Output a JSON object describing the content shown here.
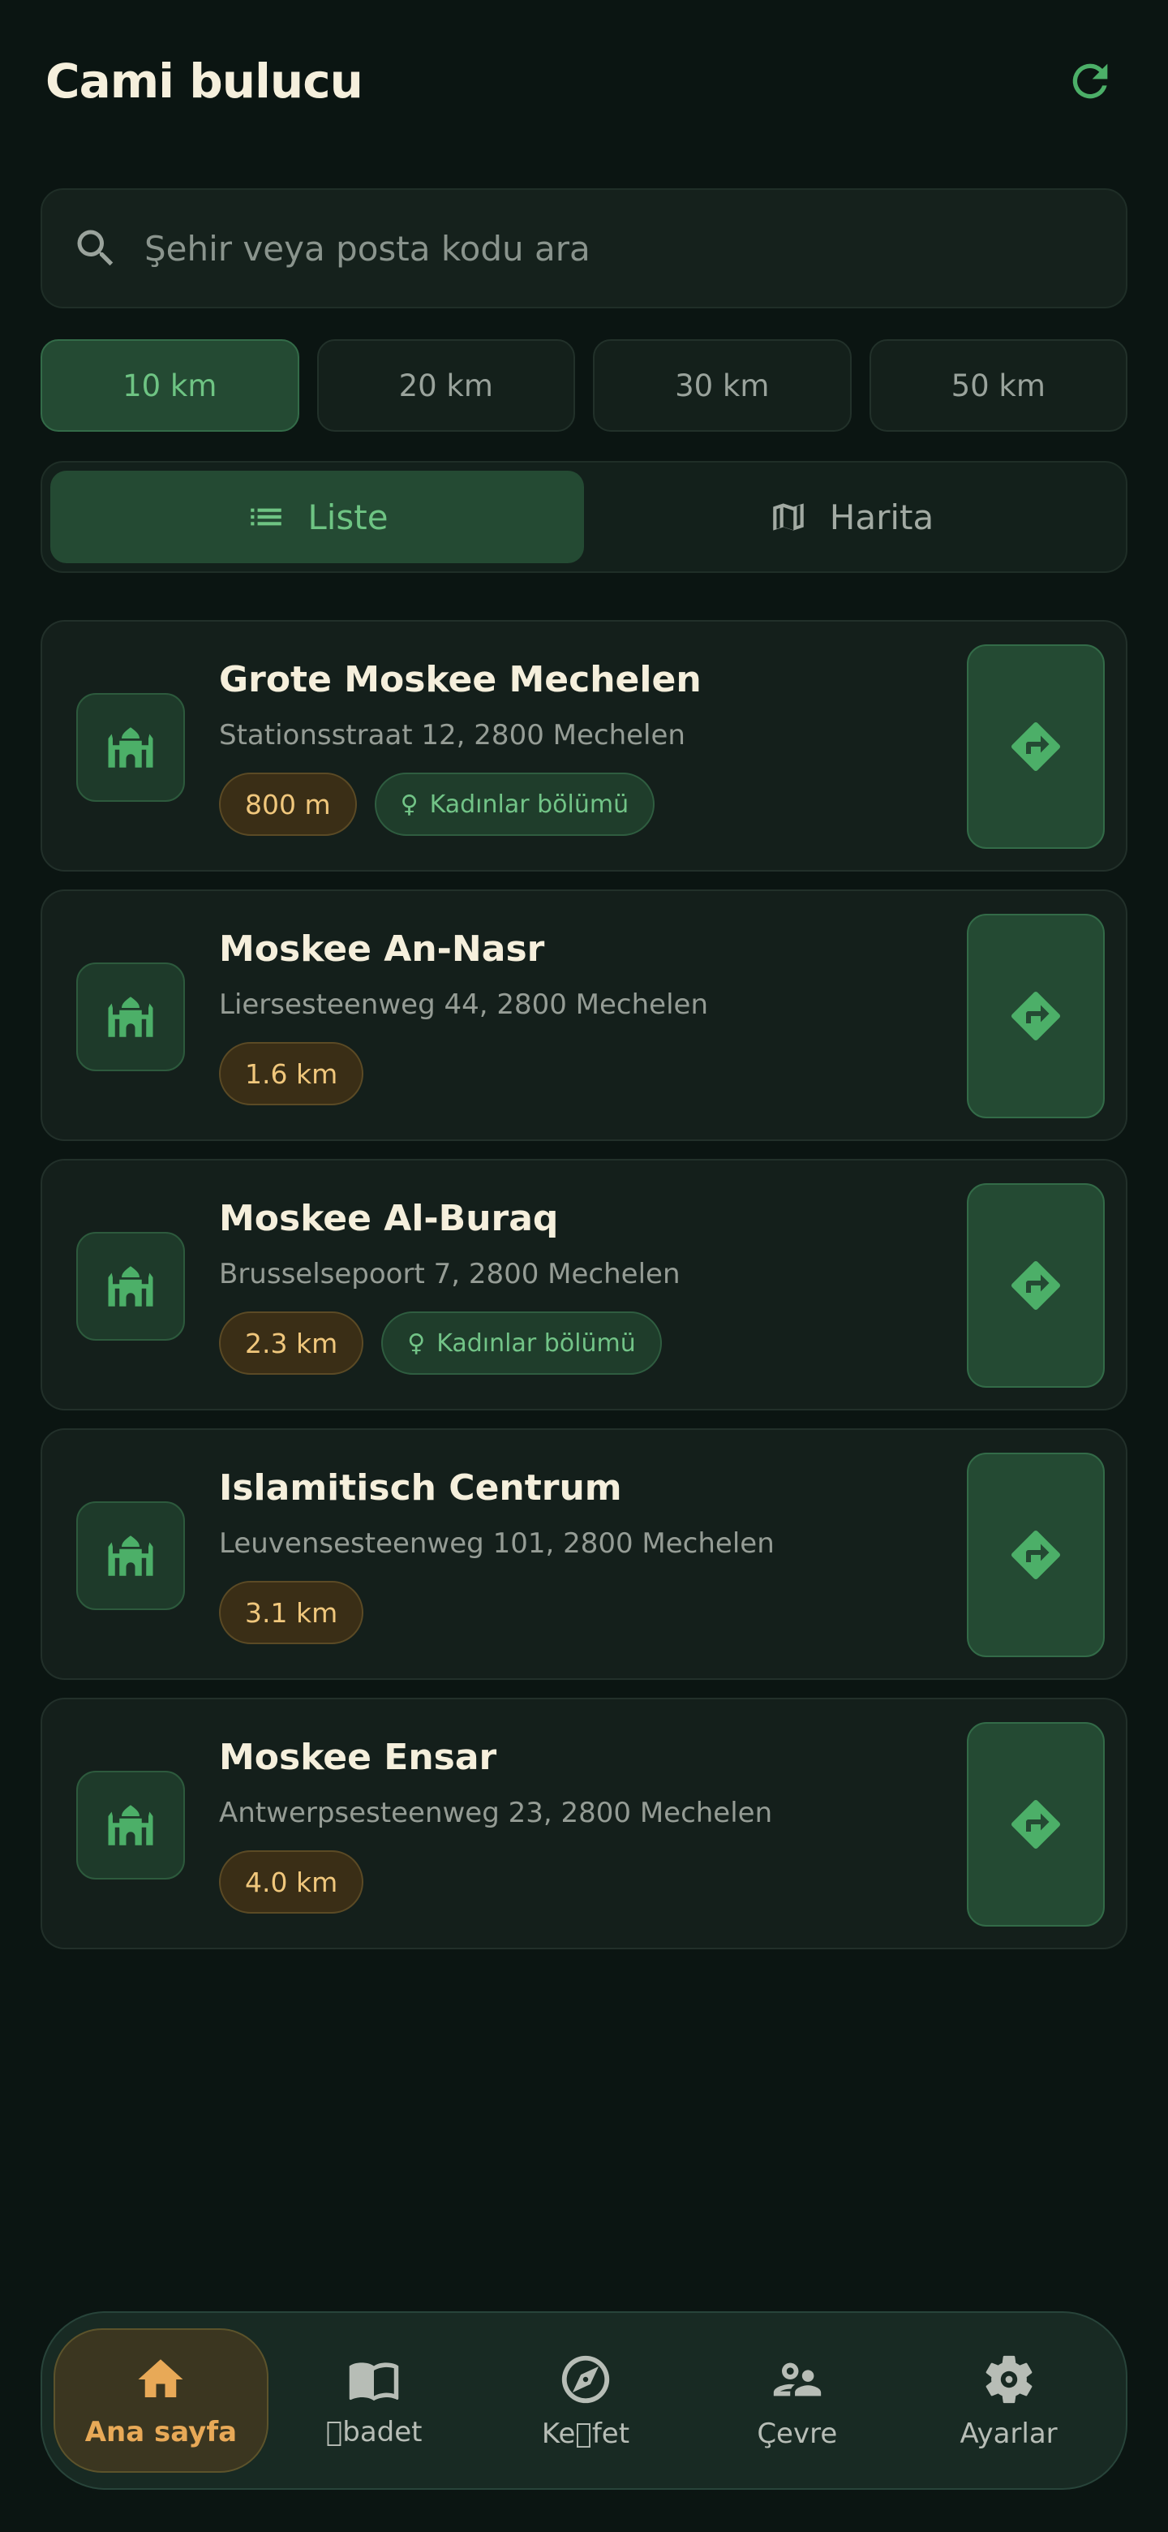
{
  "header": {
    "title": "Cami bulucu"
  },
  "search": {
    "placeholder": "Şehir veya posta kodu ara",
    "value": ""
  },
  "distance_filters": [
    "10 km",
    "20 km",
    "30 km",
    "50 km"
  ],
  "selected_distance": "10 km",
  "view_toggle": {
    "list_label": "Liste",
    "map_label": "Harita",
    "selected": "Liste"
  },
  "mosques": [
    {
      "name": "Grote Moskee Mechelen",
      "address": "Stationsstraat 12, 2800 Mechelen",
      "distance": "800 m",
      "women_section": "Kadınlar bölümü"
    },
    {
      "name": "Moskee An-Nasr",
      "address": "Liersesteenweg 44, 2800 Mechelen",
      "distance": "1.6 km",
      "women_section": null
    },
    {
      "name": "Moskee Al-Buraq",
      "address": "Brusselsepoort 7, 2800 Mechelen",
      "distance": "2.3 km",
      "women_section": "Kadınlar bölümü"
    },
    {
      "name": "Islamitisch Centrum",
      "address": "Leuvensesteenweg 101, 2800 Mechelen",
      "distance": "3.1 km",
      "women_section": null
    },
    {
      "name": "Moskee Ensar",
      "address": "Antwerpsesteenweg 23, 2800 Mechelen",
      "distance": "4.0 km",
      "women_section": null
    }
  ],
  "nav": {
    "items": [
      {
        "label": "Ana sayfa",
        "icon": "home-icon",
        "active": true
      },
      {
        "label": "\u0000badet",
        "icon": "book-icon",
        "active": false
      },
      {
        "label": "Ke\u0000fet",
        "icon": "compass-icon",
        "active": false
      },
      {
        "label": "Çevre",
        "icon": "people-icon",
        "active": false
      },
      {
        "label": "Ayarlar",
        "icon": "gear-icon",
        "active": false
      }
    ]
  },
  "colors": {
    "background": "#0b1512",
    "accent_green": "#6ec483",
    "active_green_bg": "#244a33",
    "distance_amber": "#f0c77c",
    "nav_active": "#e8a957"
  }
}
